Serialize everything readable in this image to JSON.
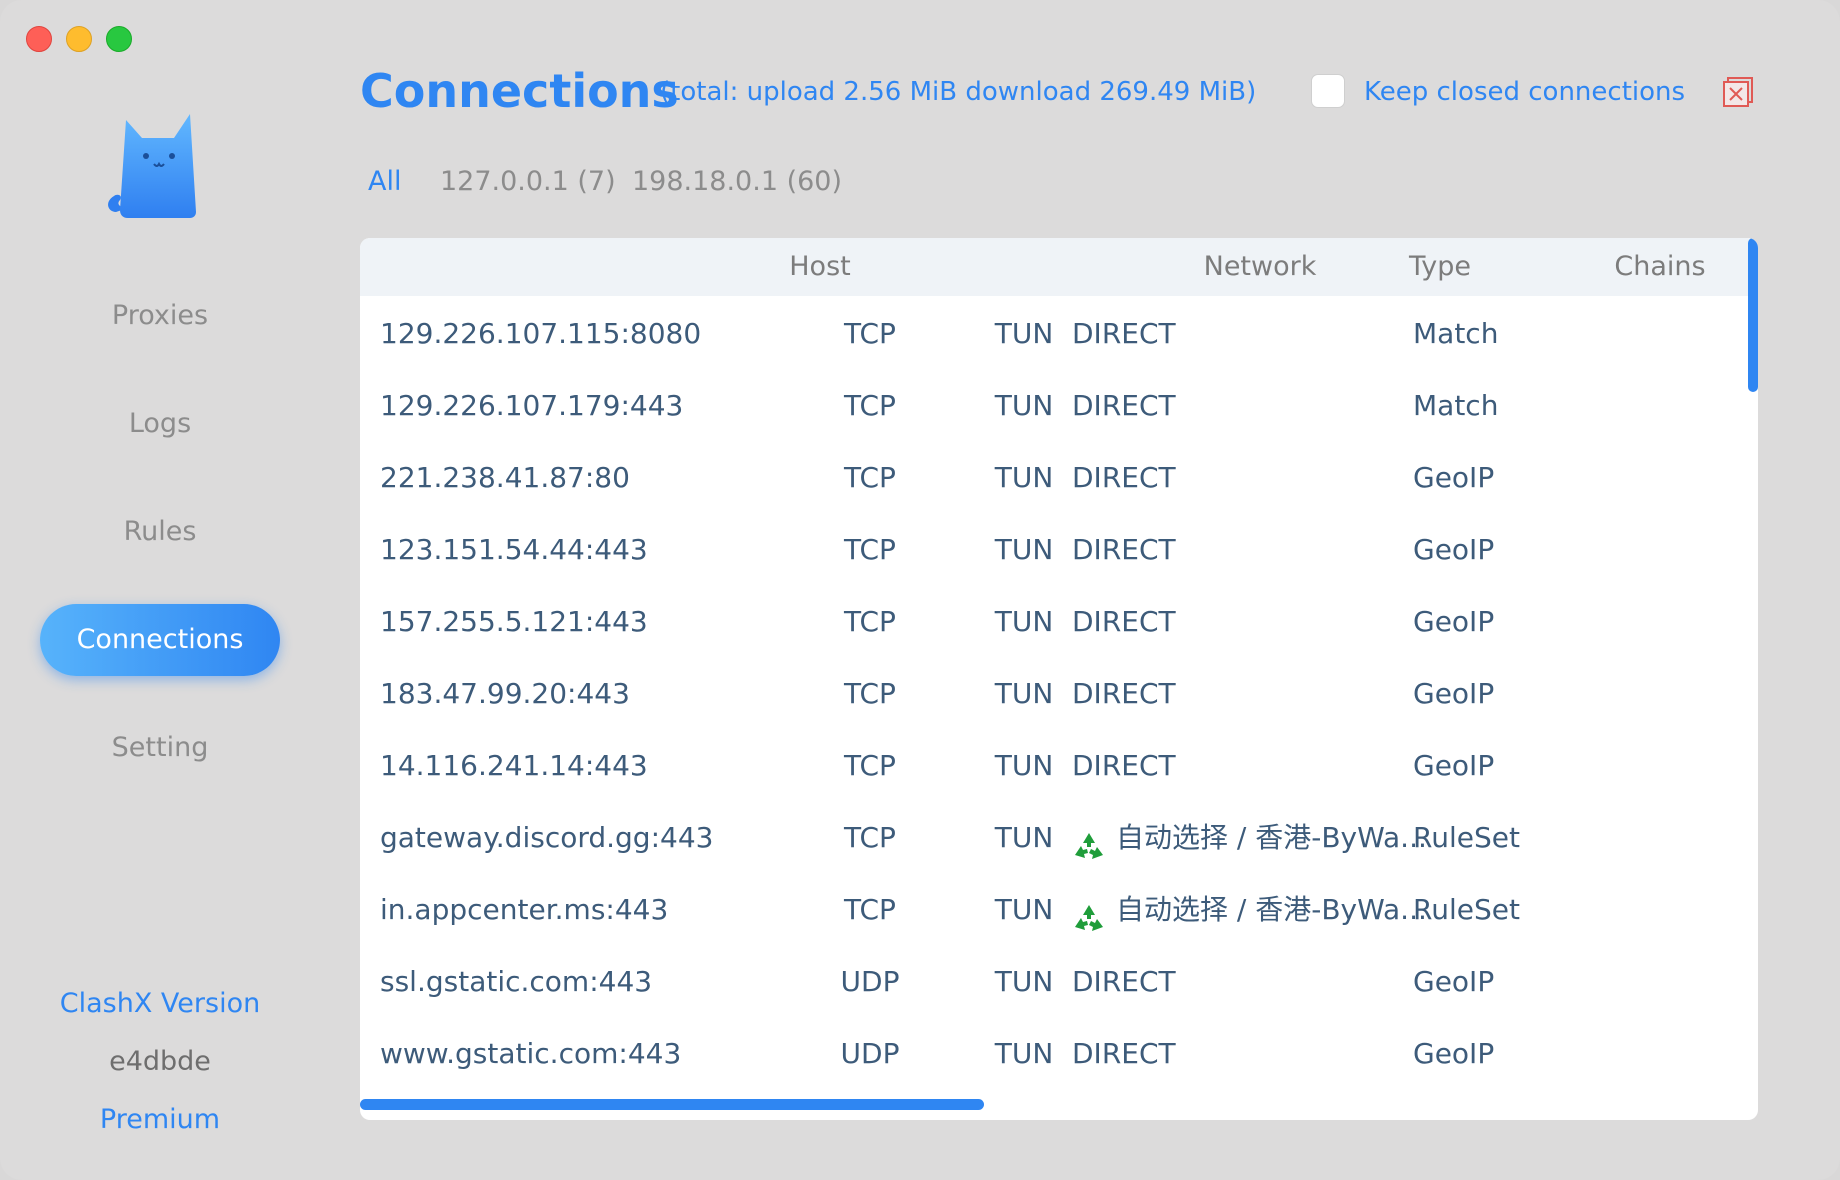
{
  "window": {
    "controls": [
      "close",
      "minimize",
      "maximize"
    ]
  },
  "sidebar": {
    "logo_icon": "cat-logo-icon",
    "items": [
      {
        "label": "Proxies",
        "active": false
      },
      {
        "label": "Logs",
        "active": false
      },
      {
        "label": "Rules",
        "active": false
      },
      {
        "label": "Connections",
        "active": true
      },
      {
        "label": "Setting",
        "active": false
      }
    ],
    "footer": {
      "version_label": "ClashX Version",
      "version_hash": "e4dbde",
      "edition": "Premium"
    }
  },
  "header": {
    "title": "Connections",
    "total": "(total: upload 2.56 MiB download 269.49 MiB)",
    "keep_closed_label": "Keep closed connections",
    "keep_closed_checked": false,
    "clear_icon": "close-all-icon"
  },
  "filters": [
    {
      "label": "All",
      "active": true
    },
    {
      "label": "127.0.0.1 (7)",
      "active": false
    },
    {
      "label": "198.18.0.1 (60)",
      "active": false
    }
  ],
  "table": {
    "columns": [
      "Host",
      "Network",
      "Type",
      "Chains"
    ],
    "rows": [
      {
        "host": "129.226.107.115:8080",
        "network": "TCP",
        "type": "TUN",
        "chain": "DIRECT",
        "chain_icon": "",
        "rule": "Match"
      },
      {
        "host": "129.226.107.179:443",
        "network": "TCP",
        "type": "TUN",
        "chain": "DIRECT",
        "chain_icon": "",
        "rule": "Match"
      },
      {
        "host": "221.238.41.87:80",
        "network": "TCP",
        "type": "TUN",
        "chain": "DIRECT",
        "chain_icon": "",
        "rule": "GeoIP"
      },
      {
        "host": "123.151.54.44:443",
        "network": "TCP",
        "type": "TUN",
        "chain": "DIRECT",
        "chain_icon": "",
        "rule": "GeoIP"
      },
      {
        "host": "157.255.5.121:443",
        "network": "TCP",
        "type": "TUN",
        "chain": "DIRECT",
        "chain_icon": "",
        "rule": "GeoIP"
      },
      {
        "host": "183.47.99.20:443",
        "network": "TCP",
        "type": "TUN",
        "chain": "DIRECT",
        "chain_icon": "",
        "rule": "GeoIP"
      },
      {
        "host": "14.116.241.14:443",
        "network": "TCP",
        "type": "TUN",
        "chain": "DIRECT",
        "chain_icon": "",
        "rule": "GeoIP"
      },
      {
        "host": "gateway.discord.gg:443",
        "network": "TCP",
        "type": "TUN",
        "chain": "自动选择 / 香港-ByWa...",
        "chain_icon": "recycle-icon",
        "rule": "RuleSet"
      },
      {
        "host": "in.appcenter.ms:443",
        "network": "TCP",
        "type": "TUN",
        "chain": "自动选择 / 香港-ByWa...",
        "chain_icon": "recycle-icon",
        "rule": "RuleSet"
      },
      {
        "host": "ssl.gstatic.com:443",
        "network": "UDP",
        "type": "TUN",
        "chain": "DIRECT",
        "chain_icon": "",
        "rule": "GeoIP"
      },
      {
        "host": "www.gstatic.com:443",
        "network": "UDP",
        "type": "TUN",
        "chain": "DIRECT",
        "chain_icon": "",
        "rule": "GeoIP"
      }
    ]
  },
  "colors": {
    "accent": "#2f86f2",
    "cell_text": "#3d5b7a",
    "muted": "#8c8c8c"
  }
}
